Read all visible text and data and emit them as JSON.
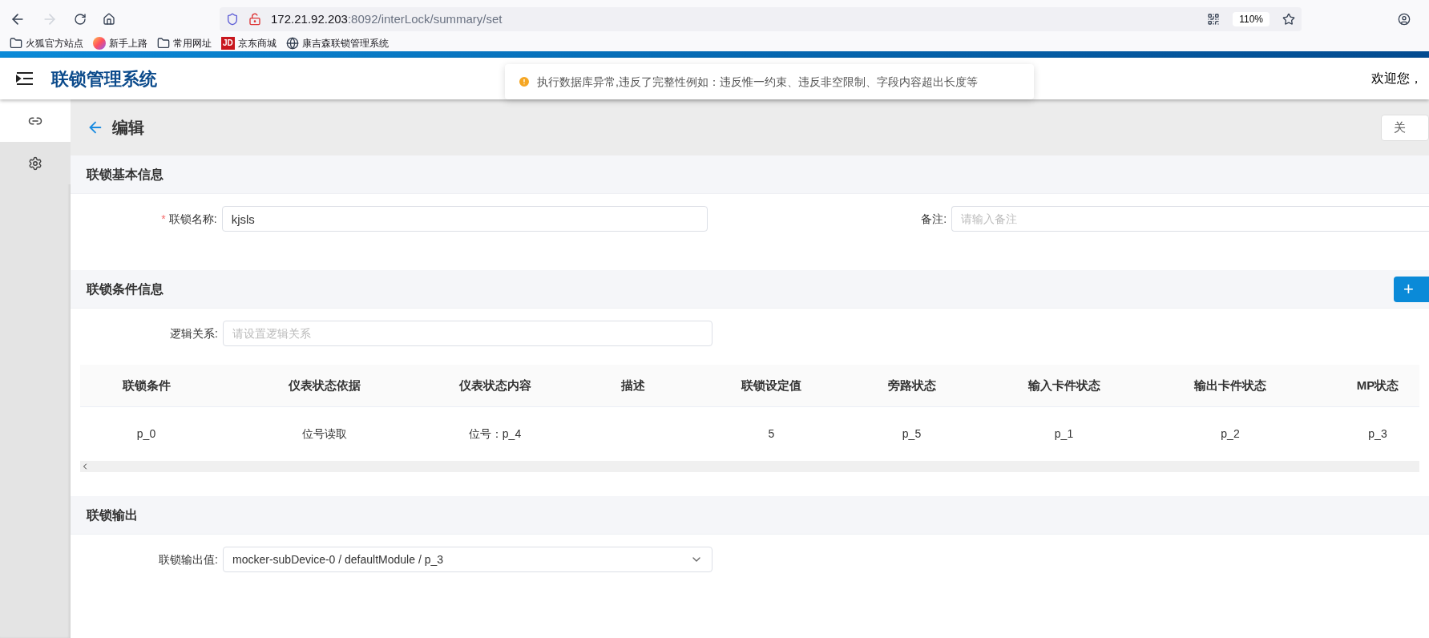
{
  "browser": {
    "url_host": "172.21.92.203",
    "url_path": ":8092/interLock/summary/set",
    "zoom": "110%",
    "bookmarks": [
      {
        "kind": "folder",
        "label": "火狐官方站点"
      },
      {
        "kind": "firefox",
        "label": "新手上路"
      },
      {
        "kind": "folder",
        "label": "常用网址"
      },
      {
        "kind": "jd",
        "logo": "JD",
        "label": "京东商城"
      },
      {
        "kind": "globe",
        "label": "康吉森联锁管理系统"
      }
    ]
  },
  "app": {
    "title": "联锁管理系统",
    "welcome": "欢迎您，"
  },
  "toast": {
    "message": "执行数据库异常,违反了完整性例如：违反惟一约束、违反非空限制、字段内容超出长度等"
  },
  "sidebar": {
    "items": [
      {
        "kind": "link",
        "selected": true
      },
      {
        "kind": "settings",
        "selected": false
      }
    ]
  },
  "page": {
    "title": "编辑",
    "close_button": "关"
  },
  "basic_info": {
    "title": "联锁基本信息",
    "name_field": {
      "required_mark": "*",
      "label": "联锁名称:",
      "value": "kjsls"
    },
    "remark_field": {
      "label": "备注:",
      "placeholder": "请输入备注"
    }
  },
  "conditions": {
    "title": "联锁条件信息",
    "add_button": "+",
    "logic_field": {
      "label": "逻辑关系:",
      "placeholder": "请设置逻辑关系"
    },
    "table": {
      "columns": [
        "联锁条件",
        "仪表状态依据",
        "仪表状态内容",
        "描述",
        "联锁设定值",
        "旁路状态",
        "输入卡件状态",
        "输出卡件状态",
        "MP状态"
      ],
      "rows": [
        [
          "p_0",
          "位号读取",
          "位号：p_4",
          "",
          "5",
          "p_5",
          "p_1",
          "p_2",
          "p_3"
        ]
      ]
    }
  },
  "output": {
    "title": "联锁输出",
    "field": {
      "label": "联锁输出值:",
      "value": "mocker-subDevice-0 / defaultModule / p_3"
    }
  }
}
